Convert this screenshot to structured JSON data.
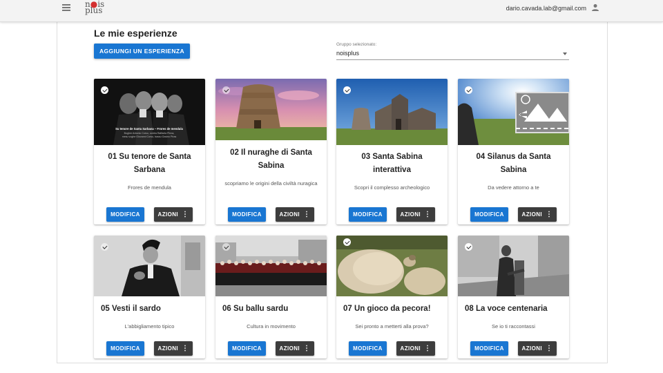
{
  "header": {
    "logo_top": "nois",
    "logo_bottom": "plus",
    "user_email": "dario.cavada.lab@gmail.com"
  },
  "page": {
    "title": "Le mie esperienze",
    "add_button": "AGGIUNGI UN ESPERIENZA",
    "group_label": "Gruppo selezionato:",
    "group_value": "noisplus"
  },
  "buttons": {
    "edit": "MODIFICA",
    "actions": "AZIONI"
  },
  "image_caption": {
    "line1": "Su tenore de Santa Sarbana – Frores de mendula",
    "line2": "Bogher Antonio Corso, contra Raffaela Pinna,",
    "line3": "mesu voghe Giovanni Corso, bassu Gavino Piras"
  },
  "cards": [
    {
      "title": "01 Su tenore de Santa Sarbana",
      "subtitle": "Frores de mendula"
    },
    {
      "title": "02 Il nuraghe di Santa Sabina",
      "subtitle": "scopriamo le origini della civiltà nuragica"
    },
    {
      "title": "03 Santa Sabina interattiva",
      "subtitle": "Scopri il complesso archeologico"
    },
    {
      "title": "04 Silanus da Santa Sabina",
      "subtitle": "Da vedere attorno a te"
    },
    {
      "title": "05 Vesti il sardo",
      "subtitle": "L'abbigliamento tipico"
    },
    {
      "title": "06 Su ballu sardu",
      "subtitle": "Cultura in movimento"
    },
    {
      "title": "07 Un gioco da pecora!",
      "subtitle": "Sei pronto a metterti alla prova?"
    },
    {
      "title": "08 La voce centenaria",
      "subtitle": "Se io ti raccontassi"
    }
  ]
}
